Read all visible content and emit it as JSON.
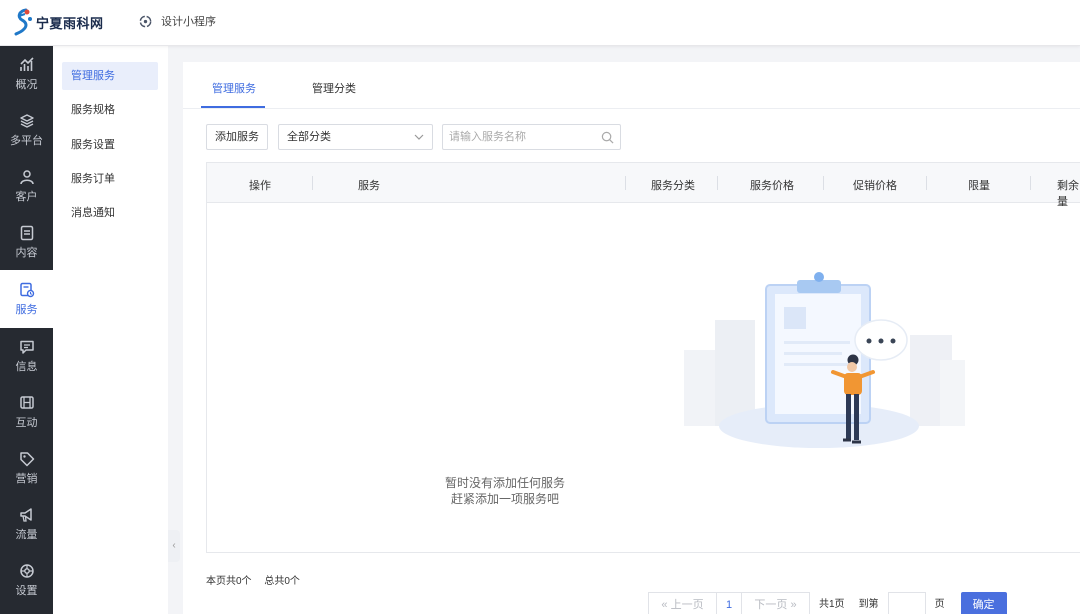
{
  "header": {
    "logo_text": "宁夏雨科网",
    "mini_program_label": "设计小程序"
  },
  "sidebar": {
    "items": [
      {
        "label": "概况",
        "icon": "chart-icon"
      },
      {
        "label": "多平台",
        "icon": "layers-icon"
      },
      {
        "label": "客户",
        "icon": "user-icon"
      },
      {
        "label": "内容",
        "icon": "document-icon"
      },
      {
        "label": "服务",
        "icon": "service-icon",
        "active": true
      },
      {
        "label": "信息",
        "icon": "message-icon"
      },
      {
        "label": "互动",
        "icon": "interaction-icon"
      },
      {
        "label": "营销",
        "icon": "tag-icon"
      },
      {
        "label": "流量",
        "icon": "megaphone-icon"
      },
      {
        "label": "设置",
        "icon": "settings-icon"
      }
    ]
  },
  "subnav": {
    "items": [
      {
        "label": "管理服务",
        "active": true
      },
      {
        "label": "服务规格"
      },
      {
        "label": "服务设置"
      },
      {
        "label": "服务订单"
      },
      {
        "label": "消息通知"
      }
    ]
  },
  "tabs": [
    {
      "label": "管理服务",
      "active": true
    },
    {
      "label": "管理分类"
    }
  ],
  "toolbar": {
    "add_label": "添加服务",
    "category_select": "全部分类",
    "search_placeholder": "请输入服务名称"
  },
  "table": {
    "columns": [
      "操作",
      "服务",
      "服务分类",
      "服务价格",
      "促销价格",
      "限量",
      "剩余量"
    ]
  },
  "empty": {
    "line1": "暂时没有添加任何服务",
    "line2": "赶紧添加一项服务吧"
  },
  "footer": {
    "page_count": "本页共0个",
    "total_count": "总共0个"
  },
  "pagination": {
    "prev": "上一页",
    "current": "1",
    "next": "下一页",
    "total_pages": "共1页",
    "goto": "到第",
    "unit": "页",
    "confirm": "确定"
  },
  "colors": {
    "accent": "#3f6ce0",
    "sidebar_bg": "#262a31",
    "confirm_bg": "#4a6fde"
  }
}
